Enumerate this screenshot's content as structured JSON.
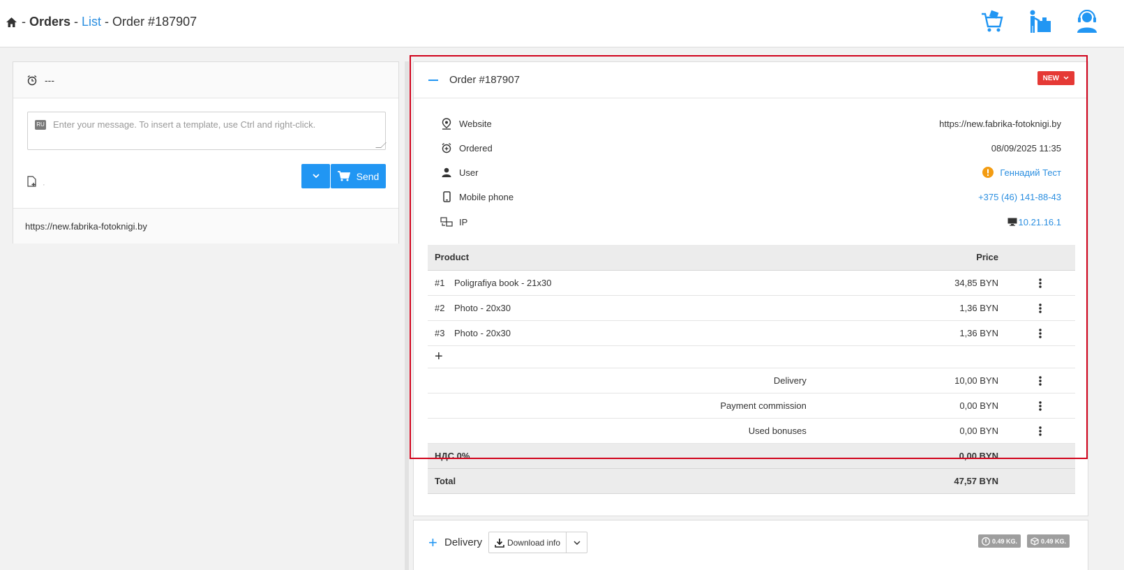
{
  "header": {
    "crumb_orders": "Orders",
    "crumb_list": "List",
    "crumb_order": "Order #187907",
    "separator": "-"
  },
  "chat": {
    "timer_text": "---",
    "lang_badge": "RU",
    "message_placeholder": "Enter your message. To insert a template, use Ctrl and right-click.",
    "attach_hint": "·",
    "send_label": "Send",
    "site_url": "https://new.fabrika-fotoknigi.by"
  },
  "order": {
    "title": "Order #187907",
    "status": "NEW",
    "info": [
      {
        "label": "Website",
        "value": "https://new.fabrika-fotoknigi.by"
      },
      {
        "label": "Ordered",
        "value": "08/09/2025 11:35"
      },
      {
        "label": "User",
        "value": "Геннадий Тест"
      },
      {
        "label": "Mobile phone",
        "value": "+375 (46) 141-88-43"
      },
      {
        "label": "IP",
        "value": "10.21.16.1"
      }
    ],
    "table": {
      "col_product": "Product",
      "col_price": "Price",
      "items": [
        {
          "num": "#1",
          "name": "Poligrafiya book - 21x30",
          "price": "34,85 BYN"
        },
        {
          "num": "#2",
          "name": "Photo - 20x30",
          "price": "1,36 BYN"
        },
        {
          "num": "#3",
          "name": "Photo - 20x30",
          "price": "1,36 BYN"
        }
      ],
      "add_symbol": "+",
      "extras": [
        {
          "label": "Delivery",
          "value": "10,00 BYN"
        },
        {
          "label": "Payment commission",
          "value": "0,00 BYN"
        },
        {
          "label": "Used bonuses",
          "value": "0,00 BYN"
        }
      ],
      "vat_label": "НДС 0%",
      "vat_value": "0,00 BYN",
      "total_label": "Total",
      "total_value": "47,57 BYN"
    }
  },
  "delivery": {
    "expand_symbol": "+",
    "label": "Delivery",
    "download_label": "Download info",
    "weight_1": "0.49 KG.",
    "weight_2": "0.49 KG."
  },
  "colors": {
    "accent": "#2196f3",
    "link": "#2a8ee0",
    "status_new": "#e53935",
    "warning": "#f39c12",
    "highlight": "#d0021b"
  }
}
